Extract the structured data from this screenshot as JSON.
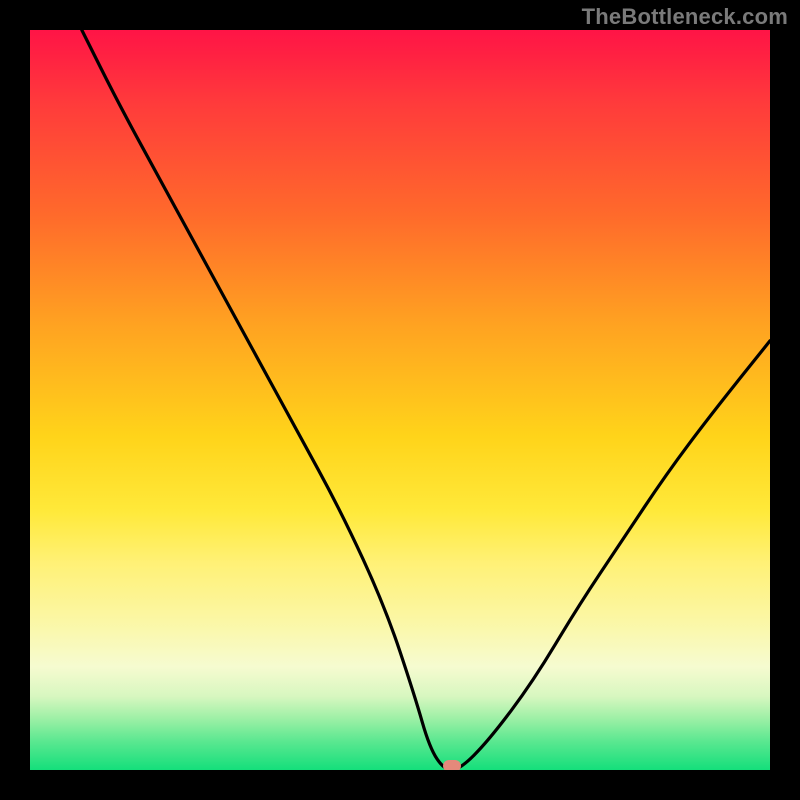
{
  "watermark": "TheBottleneck.com",
  "chart_data": {
    "type": "line",
    "title": "",
    "xlabel": "",
    "ylabel": "",
    "xlim": [
      0,
      100
    ],
    "ylim": [
      0,
      100
    ],
    "grid": false,
    "legend": false,
    "series": [
      {
        "name": "bottleneck-curve",
        "x": [
          7,
          12,
          18,
          24,
          30,
          36,
          42,
          48,
          52,
          54,
          56,
          58,
          62,
          68,
          74,
          80,
          86,
          92,
          100
        ],
        "y": [
          100,
          90,
          79,
          68,
          57,
          46,
          35,
          22,
          10,
          3,
          0,
          0,
          4,
          12,
          22,
          31,
          40,
          48,
          58
        ]
      }
    ],
    "optimal_marker": {
      "x": 57,
      "y": 0
    },
    "background_gradient_stops": [
      {
        "pos": 0.0,
        "color": "#ff1446"
      },
      {
        "pos": 0.25,
        "color": "#ff6a2b"
      },
      {
        "pos": 0.55,
        "color": "#ffd41a"
      },
      {
        "pos": 0.8,
        "color": "#fbf7a6"
      },
      {
        "pos": 1.0,
        "color": "#14df7b"
      }
    ]
  }
}
